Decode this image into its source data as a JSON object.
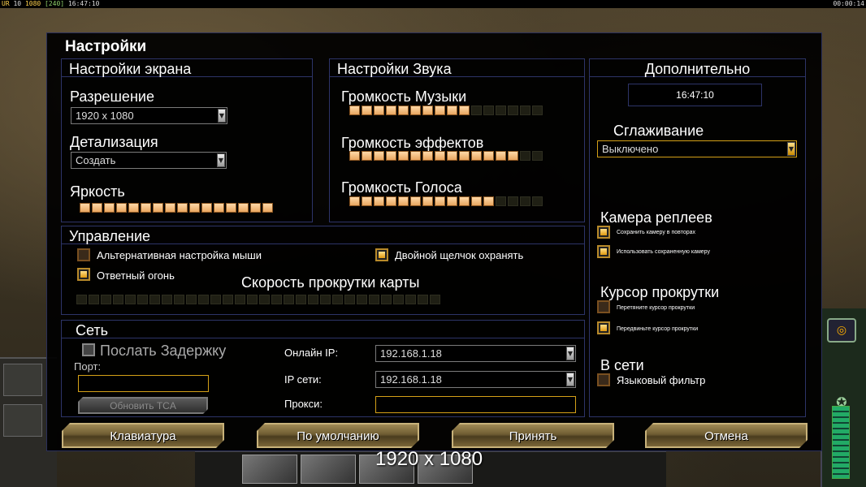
{
  "hud": {
    "top_left_a": "UR",
    "top_left_b": "10",
    "top_left_c": "1080",
    "top_left_d": "[240]",
    "top_left_time": "16:47:10",
    "top_right_time": "00:00:14"
  },
  "dialog": {
    "title": "Настройки"
  },
  "screen": {
    "title": "Настройки экрана",
    "resolution_label": "Разрешение",
    "resolution_value": "1920 x 1080",
    "detail_label": "Детализация",
    "detail_value": "Создать",
    "brightness_label": "Яркость",
    "brightness_level": 16,
    "brightness_max": 16
  },
  "sound": {
    "title": "Настройки Звука",
    "music_label": "Громкость Музыки",
    "music_level": 10,
    "music_max": 16,
    "effects_label": "Громкость эффектов",
    "effects_level": 14,
    "effects_max": 16,
    "voice_label": "Громкость Голоса",
    "voice_level": 12,
    "voice_max": 16
  },
  "extra": {
    "title": "Дополнительно",
    "clock": "16:47:10",
    "antialias_label": "Сглаживание",
    "antialias_value": "Выключено",
    "replay_camera_label": "Камера реплеев",
    "save_camera_label": "Сохранить камеру в повторах",
    "use_saved_camera_label": "Использовать сохраненную камеру",
    "scroll_cursor_label": "Курсор прокрутки",
    "drag_cursor_label": "Перетяните курсор прокрутки",
    "move_cursor_label": "Передвиньте курсор прокрутки",
    "online_label": "В сети",
    "language_filter_label": "Языковый фильтр"
  },
  "controls": {
    "title": "Управление",
    "alt_mouse_label": "Альтернативная настройка мыши",
    "double_click_label": "Двойной щелчок охранять",
    "return_fire_label": "Ответный огонь",
    "scroll_speed_label": "Скорость прокрутки карты",
    "scroll_speed_level": 0,
    "scroll_speed_max": 30
  },
  "network": {
    "title": "Сеть",
    "send_delay_label": "Послать Задержку",
    "port_label": "Порт:",
    "update_tca_label": "Обновить TCA",
    "online_ip_label": "Онлайн IP:",
    "online_ip_value": "192.168.1.18",
    "lan_ip_label": "IP сети:",
    "lan_ip_value": "192.168.1.18",
    "proxy_label": "Прокси:"
  },
  "buttons": {
    "keyboard": "Клавиатура",
    "defaults": "По умолчанию",
    "accept": "Принять",
    "cancel": "Отмена"
  },
  "overlay": {
    "resolution_text": "1920 x 1080"
  },
  "colors": {
    "accent_gold": "#d4a017",
    "slider_on": "#ffd9a8",
    "panel_border": "#2d3468"
  }
}
